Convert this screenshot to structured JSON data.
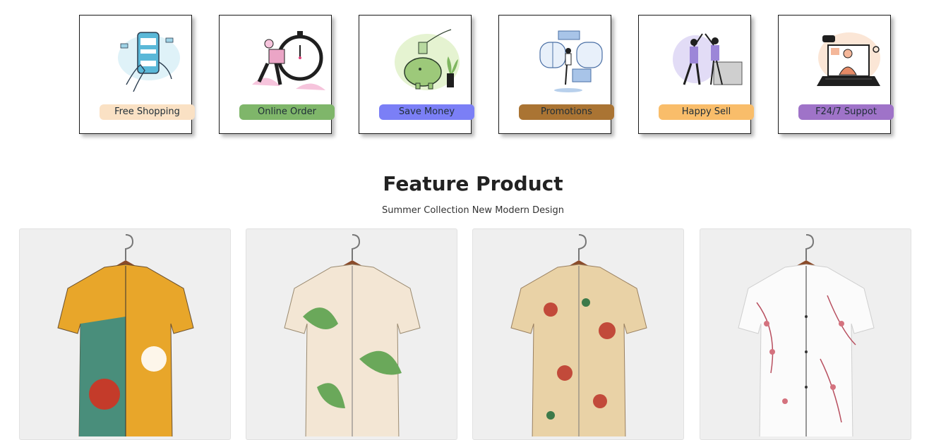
{
  "features": [
    {
      "label": "Free Shopping",
      "color": "#fae1c4",
      "icon": "phone-payment-icon"
    },
    {
      "label": "Online Order",
      "color": "#7fb66a",
      "icon": "delivery-stopwatch-icon"
    },
    {
      "label": "Save Money",
      "color": "#7b7ff6",
      "icon": "piggy-bank-icon"
    },
    {
      "label": "Promotions",
      "color": "#aa7433",
      "icon": "promotion-window-icon"
    },
    {
      "label": "Happy Sell",
      "color": "#f9bd6a",
      "icon": "high-five-icon"
    },
    {
      "label": "F24/7 Suppot",
      "color": "#9f73c8",
      "icon": "laptop-support-icon"
    }
  ],
  "section": {
    "title": "Feature Product",
    "subtitle": "Summer Collection New Modern Design"
  },
  "products": [
    {
      "image": "shirt-abstract-floral-image",
      "colors": [
        "#e8a62a",
        "#2d8a8a",
        "#c43b2a"
      ]
    },
    {
      "image": "shirt-green-leaf-image",
      "colors": [
        "#f3e6d4",
        "#6aa85a",
        "#f0d8b8"
      ]
    },
    {
      "image": "shirt-rose-floral-image",
      "colors": [
        "#e9d2a6",
        "#c24a3a",
        "#3d7a4a"
      ]
    },
    {
      "image": "shirt-pink-blossom-image",
      "colors": [
        "#fbfbfb",
        "#d4727e",
        "#b85060"
      ]
    }
  ]
}
